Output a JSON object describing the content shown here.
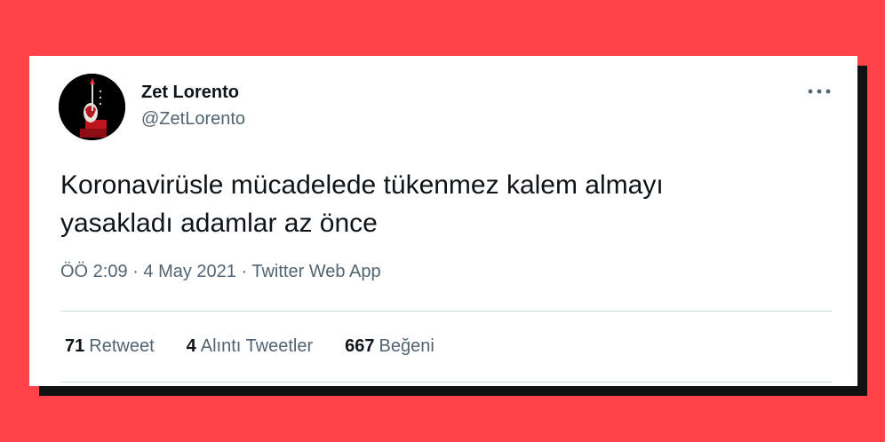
{
  "tweet": {
    "author_name": "Zet Lorento",
    "author_handle": "@ZetLorento",
    "text_line1": "Koronavirüsle mücadelede tükenmez kalem almayı",
    "text_line2": "yasakladı adamlar az önce",
    "time": "ÖÖ 2:09",
    "separator": "·",
    "date": "4 May 2021",
    "source": "Twitter Web App",
    "stats": [
      {
        "count": "71",
        "label": "Retweet"
      },
      {
        "count": "4",
        "label": "Alıntı Tweetler"
      },
      {
        "count": "667",
        "label": "Beğeni"
      }
    ],
    "more_icon": "more-horizontal-icon"
  },
  "colors": {
    "background": "#ff4349",
    "text_primary": "#0f1419",
    "text_secondary": "#536471",
    "divider": "#cfd9de"
  }
}
